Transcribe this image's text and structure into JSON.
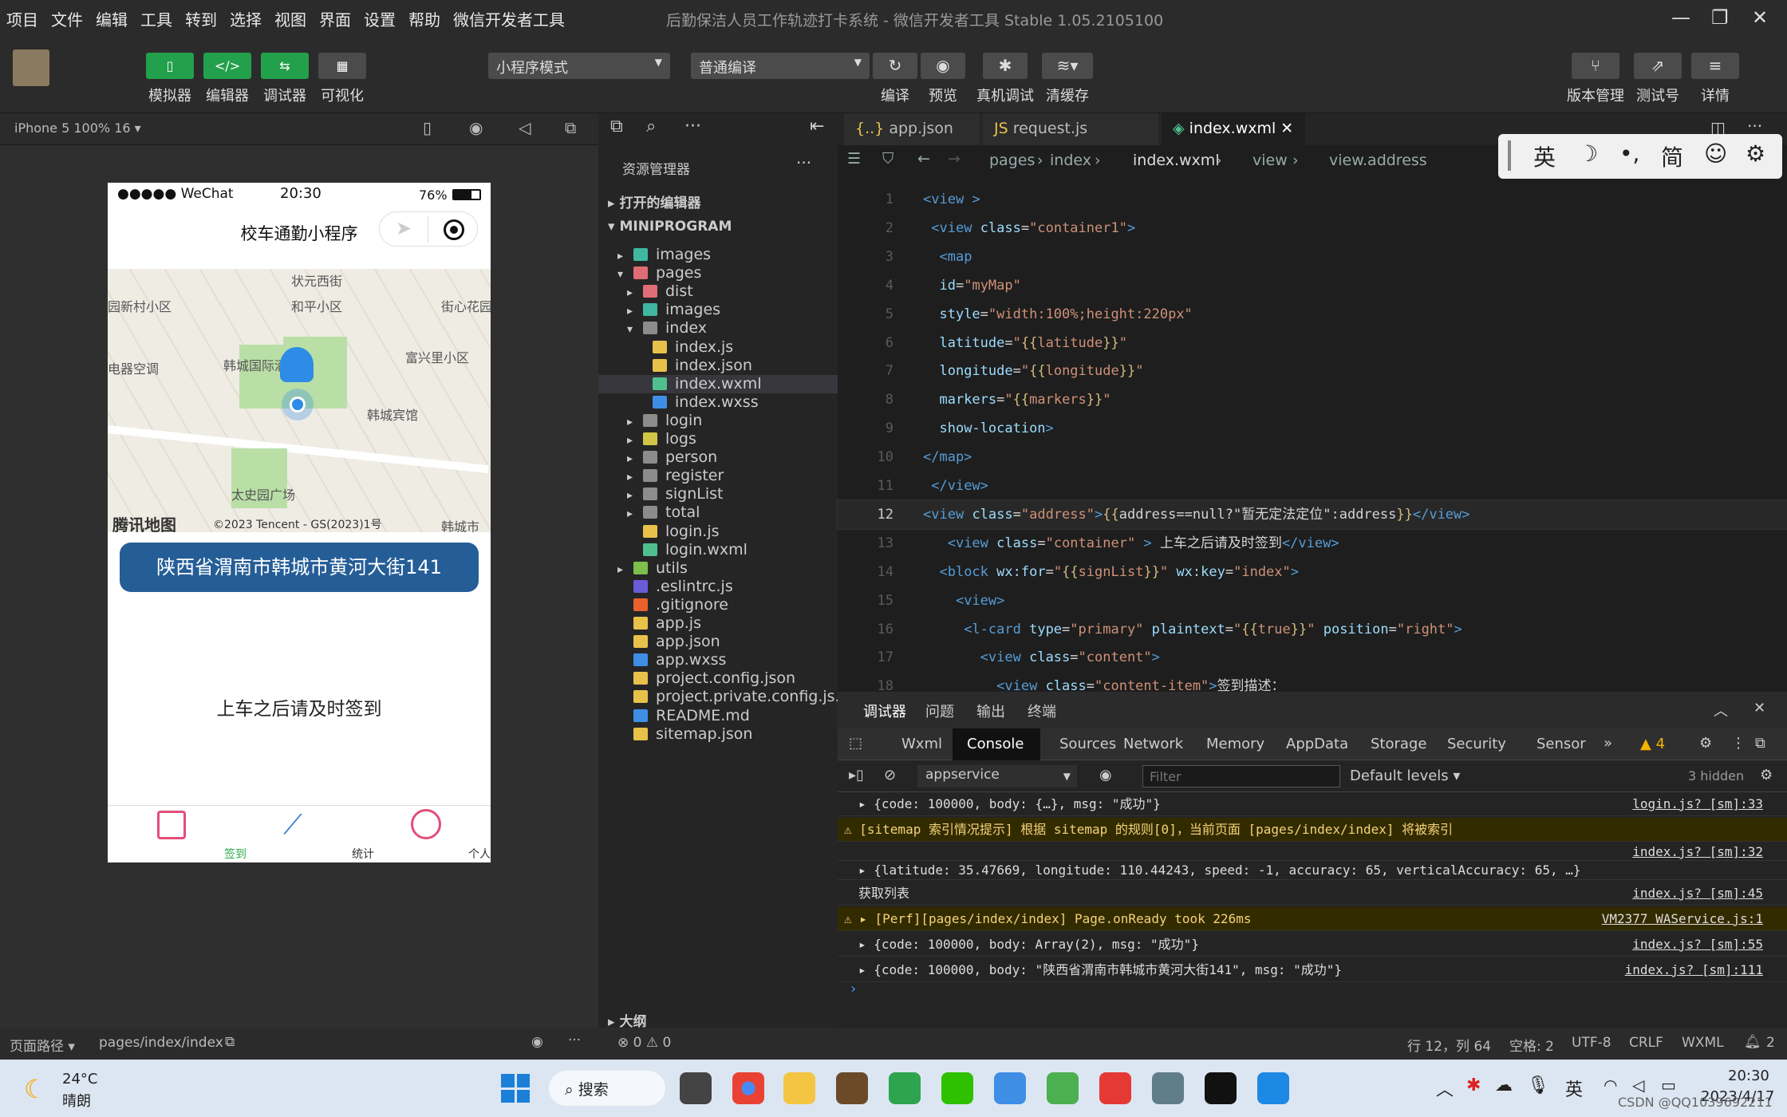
{
  "menu": [
    "项目",
    "文件",
    "编辑",
    "工具",
    "转到",
    "选择",
    "视图",
    "界面",
    "设置",
    "帮助",
    "微信开发者工具"
  ],
  "window_title": "后勤保洁人员工作轨迹打卡系统 - 微信开发者工具 Stable 1.05.2105100",
  "toolbar": {
    "simulator": "模拟器",
    "editor": "编辑器",
    "debugger": "调试器",
    "visual": "可视化",
    "mode_select": "小程序模式",
    "compile_select": "普通编译",
    "compile": "编译",
    "preview": "预览",
    "real_debug": "真机调试",
    "clear_cache": "清缓存",
    "version": "版本管理",
    "test_no": "测试号",
    "details": "详情"
  },
  "sim": {
    "device": "iPhone 5 100% 16 ▾",
    "status_left": "●●●●● WeChat",
    "time": "20:30",
    "battery": "76%",
    "nav_title": "校车通勤小程序",
    "map_labels": [
      "状元西街",
      "和平小区",
      "街心花园",
      "园新村小区",
      "韩城国际酒店",
      "富兴里小区",
      "电器空调",
      "韩城宾馆",
      "太史园广场",
      "韩城市"
    ],
    "map_logo": "腾讯地图",
    "map_copyright": "©2023 Tencent - GS(2023)1号",
    "address": "陕西省渭南市韩城市黄河大街141",
    "reminder": "上车之后请及时签到",
    "tabs": [
      "签到",
      "统计",
      "个人中心"
    ]
  },
  "explorer": {
    "title": "资源管理器",
    "open_editors": "打开的编辑器",
    "project": "MINIPROGRAM",
    "items": [
      {
        "name": "images",
        "depth": 1,
        "arrow": "▸",
        "type": "folder-special"
      },
      {
        "name": "pages",
        "depth": 1,
        "arrow": "▾",
        "type": "folder-red"
      },
      {
        "name": "dist",
        "depth": 2,
        "arrow": "▸",
        "type": "folder-red"
      },
      {
        "name": "images",
        "depth": 2,
        "arrow": "▸",
        "type": "folder-special"
      },
      {
        "name": "index",
        "depth": 2,
        "arrow": "▾",
        "type": "folder"
      },
      {
        "name": "index.js",
        "depth": 3,
        "arrow": "",
        "type": "js"
      },
      {
        "name": "index.json",
        "depth": 3,
        "arrow": "",
        "type": "json"
      },
      {
        "name": "index.wxml",
        "depth": 3,
        "arrow": "",
        "type": "wxml"
      },
      {
        "name": "index.wxss",
        "depth": 3,
        "arrow": "",
        "type": "wxss"
      },
      {
        "name": "login",
        "depth": 2,
        "arrow": "▸",
        "type": "folder"
      },
      {
        "name": "logs",
        "depth": 2,
        "arrow": "▸",
        "type": "folder-yellow"
      },
      {
        "name": "person",
        "depth": 2,
        "arrow": "▸",
        "type": "folder"
      },
      {
        "name": "register",
        "depth": 2,
        "arrow": "▸",
        "type": "folder"
      },
      {
        "name": "signList",
        "depth": 2,
        "arrow": "▸",
        "type": "folder"
      },
      {
        "name": "total",
        "depth": 2,
        "arrow": "▸",
        "type": "folder"
      },
      {
        "name": "login.js",
        "depth": 2,
        "arrow": "",
        "type": "js"
      },
      {
        "name": "login.wxml",
        "depth": 2,
        "arrow": "",
        "type": "wxml"
      },
      {
        "name": "utils",
        "depth": 1,
        "arrow": "▸",
        "type": "folder-green"
      },
      {
        "name": ".eslintrc.js",
        "depth": 1,
        "arrow": "",
        "type": "eslint"
      },
      {
        "name": ".gitignore",
        "depth": 1,
        "arrow": "",
        "type": "git"
      },
      {
        "name": "app.js",
        "depth": 1,
        "arrow": "",
        "type": "js"
      },
      {
        "name": "app.json",
        "depth": 1,
        "arrow": "",
        "type": "json"
      },
      {
        "name": "app.wxss",
        "depth": 1,
        "arrow": "",
        "type": "wxss"
      },
      {
        "name": "project.config.json",
        "depth": 1,
        "arrow": "",
        "type": "json"
      },
      {
        "name": "project.private.config.js...",
        "depth": 1,
        "arrow": "",
        "type": "json"
      },
      {
        "name": "README.md",
        "depth": 1,
        "arrow": "",
        "type": "info"
      },
      {
        "name": "sitemap.json",
        "depth": 1,
        "arrow": "",
        "type": "json"
      }
    ],
    "outline": "大纲"
  },
  "editor": {
    "tabs": [
      "app.json",
      "request.js",
      "index.wxml"
    ],
    "breadcrumb": [
      "pages",
      "index",
      "index.wxml",
      "view",
      "view.address"
    ],
    "lines": [
      {
        "n": "1",
        "html": "<span class='t'>&lt;view</span> <span class='t'>&gt;</span>"
      },
      {
        "n": "2",
        "html": " <span class='t'>&lt;view</span> <span class='a'>class</span><span class='w'>=</span><span class='s'>\"container1\"</span><span class='t'>&gt;</span>"
      },
      {
        "n": "3",
        "html": "  <span class='t'>&lt;map</span>"
      },
      {
        "n": "4",
        "html": "  <span class='a'>id</span><span class='w'>=</span><span class='s'>\"myMap\"</span>"
      },
      {
        "n": "5",
        "html": "  <span class='a'>style</span><span class='w'>=</span><span class='s'>\"width:100%;height:220px\"</span>"
      },
      {
        "n": "6",
        "html": "  <span class='a'>latitude</span><span class='w'>=</span><span class='s'>\"</span><span class='b'>{{</span><span class='s'>latitude</span><span class='b'>}}</span><span class='s'>\"</span>"
      },
      {
        "n": "7",
        "html": "  <span class='a'>longitude</span><span class='w'>=</span><span class='s'>\"</span><span class='b'>{{</span><span class='s'>longitude</span><span class='b'>}}</span><span class='s'>\"</span>"
      },
      {
        "n": "8",
        "html": "  <span class='a'>markers</span><span class='w'>=</span><span class='s'>\"</span><span class='b'>{{</span><span class='s'>markers</span><span class='b'>}}</span><span class='s'>\"</span>"
      },
      {
        "n": "9",
        "html": "  <span class='a'>show-location</span><span class='t'>&gt;</span>"
      },
      {
        "n": "10",
        "html": "<span class='t'>&lt;/map&gt;</span>"
      },
      {
        "n": "11",
        "html": " <span class='t'>&lt;/view&gt;</span>"
      },
      {
        "n": "12",
        "html": "<span class='t'>&lt;view</span> <span class='a'>class</span><span class='w'>=</span><span class='s'>\"address\"</span><span class='t'>&gt;</span><span class='b'>{{</span><span class='w'>address==null?\"暂无定法定位\":address</span><span class='b'>}}</span><span class='t'>&lt;/view&gt;</span>"
      },
      {
        "n": "13",
        "html": "   <span class='t'>&lt;view</span> <span class='a'>class</span><span class='w'>=</span><span class='s'>\"container\"</span> <span class='t'>&gt;</span> <span class='w'>上车之后请及时签到</span><span class='t'>&lt;/view&gt;</span>"
      },
      {
        "n": "14",
        "html": "  <span class='t'>&lt;block</span> <span class='a'>wx:for</span><span class='w'>=</span><span class='s'>\"</span><span class='b'>{{</span><span class='s'>signList</span><span class='b'>}}</span><span class='s'>\"</span> <span class='a'>wx:key</span><span class='w'>=</span><span class='s'>\"index\"</span><span class='t'>&gt;</span>"
      },
      {
        "n": "15",
        "html": "    <span class='t'>&lt;view&gt;</span>"
      },
      {
        "n": "16",
        "html": "     <span class='t'>&lt;l-card</span> <span class='a'>type</span><span class='w'>=</span><span class='s'>\"primary\"</span> <span class='a'>plaintext</span><span class='w'>=</span><span class='s'>\"</span><span class='b'>{{</span><span class='s'>true</span><span class='b'>}}</span><span class='s'>\"</span> <span class='a'>position</span><span class='w'>=</span><span class='s'>\"right\"</span><span class='t'>&gt;</span>"
      },
      {
        "n": "17",
        "html": "       <span class='t'>&lt;view</span> <span class='a'>class</span><span class='w'>=</span><span class='s'>\"content\"</span><span class='t'>&gt;</span>"
      },
      {
        "n": "18",
        "html": "         <span class='t'>&lt;view</span> <span class='a'>class</span><span class='w'>=</span><span class='s'>\"content-item\"</span><span class='t'>&gt;</span><span class='w'>签到描述：</span>"
      }
    ]
  },
  "ime": {
    "lang": "英",
    "moon": "☽",
    "punct": "•,",
    "simp": "简",
    "emoji": "☺",
    "gear": "⚙"
  },
  "debugger": {
    "top_tabs": [
      "调试器",
      "问题",
      "输出",
      "终端"
    ],
    "panel_tabs": [
      "Wxml",
      "Console",
      "Sources",
      "Network",
      "Memory",
      "AppData",
      "Storage",
      "Security",
      "Sensor"
    ],
    "warn_count": "4",
    "context": "appservice",
    "filter_placeholder": "Filter",
    "levels": "Default levels",
    "hidden": "3 hidden",
    "logs": [
      {
        "warn": false,
        "text": "▸ {code: 100000, body: {…}, msg: \"成功\"}",
        "src": "login.js? [sm]:33"
      },
      {
        "warn": true,
        "text": "[sitemap 索引情况提示] 根据 sitemap 的规则[0]，当前页面 [pages/index/index] 将被索引",
        "src": ""
      },
      {
        "warn": false,
        "text": "",
        "src": "index.js? [sm]:32"
      },
      {
        "warn": false,
        "text": "▸ {latitude: 35.47669, longitude: 110.44243, speed: -1, accuracy: 65, verticalAccuracy: 65, …}",
        "src": ""
      },
      {
        "warn": false,
        "text": "获取列表",
        "src": "index.js? [sm]:45"
      },
      {
        "warn": true,
        "text": "▸ [Perf][pages/index/index] Page.onReady took 226ms",
        "src": "VM2377 WAService.js:1"
      },
      {
        "warn": false,
        "text": "▸ {code: 100000, body: Array(2), msg: \"成功\"}",
        "src": "index.js? [sm]:55"
      },
      {
        "warn": false,
        "text": "▸ {code: 100000, body: \"陕西省渭南市韩城市黄河大街141\", msg: \"成功\"}",
        "src": "index.js? [sm]:111"
      }
    ]
  },
  "statusbar": {
    "path_label": "页面路径 ▾",
    "path": "pages/index/index",
    "errors": "⊗ 0 ⚠ 0",
    "cursor": "行 12，列 64",
    "spaces": "空格: 2",
    "encoding": "UTF-8",
    "eol": "CRLF",
    "lang": "WXML",
    "bell": "2"
  },
  "taskbar": {
    "temp": "24°C",
    "weather": "晴朗",
    "search": "搜索",
    "tray_lang": "英",
    "time": "20:30",
    "date": "2023/4/17",
    "watermark": "CSDN @QQ1039692211"
  }
}
